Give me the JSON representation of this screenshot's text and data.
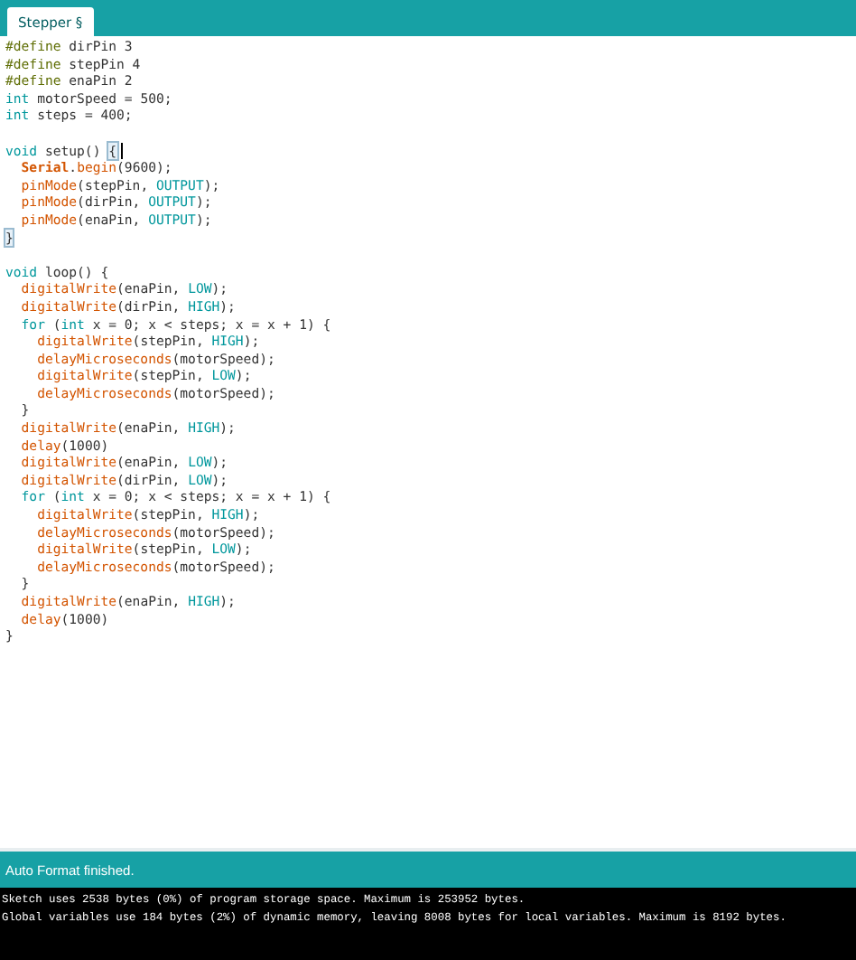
{
  "tabs": [
    {
      "label": "Stepper §",
      "selected": true
    }
  ],
  "editor": {
    "lines": [
      {
        "segments": [
          {
            "text": "#define",
            "kind": "preproc"
          },
          {
            "text": " dirPin 3",
            "kind": "plain"
          }
        ]
      },
      {
        "segments": [
          {
            "text": "#define",
            "kind": "preproc"
          },
          {
            "text": " stepPin 4",
            "kind": "plain"
          }
        ]
      },
      {
        "segments": [
          {
            "text": "#define",
            "kind": "preproc"
          },
          {
            "text": " enaPin 2",
            "kind": "plain"
          }
        ]
      },
      {
        "segments": [
          {
            "text": "int",
            "kind": "keyword"
          },
          {
            "text": " motorSpeed = 500;",
            "kind": "plain"
          }
        ]
      },
      {
        "segments": [
          {
            "text": "int",
            "kind": "keyword"
          },
          {
            "text": " steps = 400;",
            "kind": "plain"
          }
        ]
      },
      {
        "blank_before": true,
        "segments": [
          {
            "text": "void",
            "kind": "keyword"
          },
          {
            "text": " setup() ",
            "kind": "plain"
          },
          {
            "text": "{",
            "kind": "matched",
            "caret_after": true
          }
        ]
      },
      {
        "segments": [
          {
            "text": "  Serial",
            "kind": "class"
          },
          {
            "text": ".",
            "kind": "plain"
          },
          {
            "text": "begin",
            "kind": "function"
          },
          {
            "text": "(9600);",
            "kind": "plain"
          }
        ]
      },
      {
        "segments": [
          {
            "text": "  pinMode",
            "kind": "function"
          },
          {
            "text": "(stepPin, ",
            "kind": "plain"
          },
          {
            "text": "OUTPUT",
            "kind": "constant"
          },
          {
            "text": ");",
            "kind": "plain"
          }
        ]
      },
      {
        "segments": [
          {
            "text": "  pinMode",
            "kind": "function"
          },
          {
            "text": "(dirPin, ",
            "kind": "plain"
          },
          {
            "text": "OUTPUT",
            "kind": "constant"
          },
          {
            "text": ");",
            "kind": "plain"
          }
        ]
      },
      {
        "segments": [
          {
            "text": "  pinMode",
            "kind": "function"
          },
          {
            "text": "(enaPin, ",
            "kind": "plain"
          },
          {
            "text": "OUTPUT",
            "kind": "constant"
          },
          {
            "text": ");",
            "kind": "plain"
          }
        ]
      },
      {
        "segments": [
          {
            "text": "}",
            "kind": "matched"
          }
        ]
      },
      {
        "blank_before": true,
        "segments": [
          {
            "text": "void",
            "kind": "keyword"
          },
          {
            "text": " loop() {",
            "kind": "plain"
          }
        ]
      },
      {
        "segments": [
          {
            "text": "  digitalWrite",
            "kind": "function"
          },
          {
            "text": "(enaPin, ",
            "kind": "plain"
          },
          {
            "text": "LOW",
            "kind": "constant"
          },
          {
            "text": ");",
            "kind": "plain"
          }
        ]
      },
      {
        "segments": [
          {
            "text": "  digitalWrite",
            "kind": "function"
          },
          {
            "text": "(dirPin, ",
            "kind": "plain"
          },
          {
            "text": "HIGH",
            "kind": "constant"
          },
          {
            "text": ");",
            "kind": "plain"
          }
        ]
      },
      {
        "segments": [
          {
            "text": "  for",
            "kind": "keyword"
          },
          {
            "text": " (",
            "kind": "plain"
          },
          {
            "text": "int",
            "kind": "keyword"
          },
          {
            "text": " x = 0; x < steps; x = x + 1) {",
            "kind": "plain"
          }
        ]
      },
      {
        "segments": [
          {
            "text": "    digitalWrite",
            "kind": "function"
          },
          {
            "text": "(stepPin, ",
            "kind": "plain"
          },
          {
            "text": "HIGH",
            "kind": "constant"
          },
          {
            "text": ");",
            "kind": "plain"
          }
        ]
      },
      {
        "segments": [
          {
            "text": "    delayMicroseconds",
            "kind": "function"
          },
          {
            "text": "(motorSpeed);",
            "kind": "plain"
          }
        ]
      },
      {
        "segments": [
          {
            "text": "    digitalWrite",
            "kind": "function"
          },
          {
            "text": "(stepPin, ",
            "kind": "plain"
          },
          {
            "text": "LOW",
            "kind": "constant"
          },
          {
            "text": ");",
            "kind": "plain"
          }
        ]
      },
      {
        "segments": [
          {
            "text": "    delayMicroseconds",
            "kind": "function"
          },
          {
            "text": "(motorSpeed);",
            "kind": "plain"
          }
        ]
      },
      {
        "segments": [
          {
            "text": "  }",
            "kind": "plain"
          }
        ]
      },
      {
        "segments": [
          {
            "text": "  digitalWrite",
            "kind": "function"
          },
          {
            "text": "(enaPin, ",
            "kind": "plain"
          },
          {
            "text": "HIGH",
            "kind": "constant"
          },
          {
            "text": ");",
            "kind": "plain"
          }
        ]
      },
      {
        "segments": [
          {
            "text": "  delay",
            "kind": "function"
          },
          {
            "text": "(1000)",
            "kind": "plain"
          }
        ]
      },
      {
        "segments": [
          {
            "text": "  digitalWrite",
            "kind": "function"
          },
          {
            "text": "(enaPin, ",
            "kind": "plain"
          },
          {
            "text": "LOW",
            "kind": "constant"
          },
          {
            "text": ");",
            "kind": "plain"
          }
        ]
      },
      {
        "segments": [
          {
            "text": "  digitalWrite",
            "kind": "function"
          },
          {
            "text": "(dirPin, ",
            "kind": "plain"
          },
          {
            "text": "LOW",
            "kind": "constant"
          },
          {
            "text": ");",
            "kind": "plain"
          }
        ]
      },
      {
        "segments": [
          {
            "text": "  for",
            "kind": "keyword"
          },
          {
            "text": " (",
            "kind": "plain"
          },
          {
            "text": "int",
            "kind": "keyword"
          },
          {
            "text": " x = 0; x < steps; x = x + 1) {",
            "kind": "plain"
          }
        ]
      },
      {
        "segments": [
          {
            "text": "    digitalWrite",
            "kind": "function"
          },
          {
            "text": "(stepPin, ",
            "kind": "plain"
          },
          {
            "text": "HIGH",
            "kind": "constant"
          },
          {
            "text": ");",
            "kind": "plain"
          }
        ]
      },
      {
        "segments": [
          {
            "text": "    delayMicroseconds",
            "kind": "function"
          },
          {
            "text": "(motorSpeed);",
            "kind": "plain"
          }
        ]
      },
      {
        "segments": [
          {
            "text": "    digitalWrite",
            "kind": "function"
          },
          {
            "text": "(stepPin, ",
            "kind": "plain"
          },
          {
            "text": "LOW",
            "kind": "constant"
          },
          {
            "text": ");",
            "kind": "plain"
          }
        ]
      },
      {
        "segments": [
          {
            "text": "    delayMicroseconds",
            "kind": "function"
          },
          {
            "text": "(motorSpeed);",
            "kind": "plain"
          }
        ]
      },
      {
        "segments": [
          {
            "text": "  }",
            "kind": "plain"
          }
        ]
      },
      {
        "segments": [
          {
            "text": "  digitalWrite",
            "kind": "function"
          },
          {
            "text": "(enaPin, ",
            "kind": "plain"
          },
          {
            "text": "HIGH",
            "kind": "constant"
          },
          {
            "text": ");",
            "kind": "plain"
          }
        ]
      },
      {
        "segments": [
          {
            "text": "  delay",
            "kind": "function"
          },
          {
            "text": "(1000)",
            "kind": "plain"
          }
        ]
      },
      {
        "segments": [
          {
            "text": "}",
            "kind": "plain"
          }
        ]
      }
    ]
  },
  "status_bar": {
    "message": "Auto Format finished."
  },
  "console": {
    "lines": [
      "Sketch uses 2538 bytes (0%) of program storage space. Maximum is 253952 bytes.",
      "Global variables use 184 bytes (2%) of dynamic memory, leaving 8008 bytes for local variables. Maximum is 8192 bytes."
    ]
  }
}
